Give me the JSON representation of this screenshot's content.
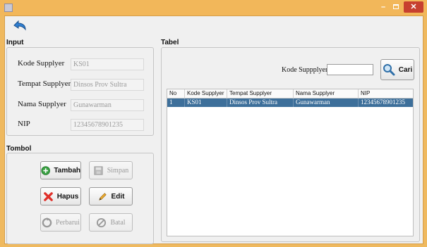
{
  "colors": {
    "titlebar": "#f2b75a",
    "close_button": "#c7402f",
    "selected_row": "#3d6f9a",
    "panel": "#f0f0f0"
  },
  "toolbar": {
    "back_icon": "back-arrow-icon"
  },
  "input_panel": {
    "title": "Input",
    "fields": [
      {
        "label": "Kode Supplyer",
        "value": "KS01"
      },
      {
        "label": "Tempat Supplyer",
        "value": "Dinsos Prov Sultra"
      },
      {
        "label": "Nama Supplyer",
        "value": "Gunawarman"
      },
      {
        "label": "NIP",
        "value": "12345678901235"
      }
    ]
  },
  "tombol_panel": {
    "title": "Tombol",
    "buttons": {
      "tambah": "Tambah",
      "simpan": "Simpan",
      "hapus": "Hapus",
      "edit": "Edit",
      "perbarui": "Perbarui",
      "batal": "Batal"
    }
  },
  "tabel_panel": {
    "title": "Tabel",
    "search_label": "Kode Suppplyer",
    "search_value": "",
    "search_button": "Cari",
    "columns": [
      "No",
      "Kode Supplyer",
      "Tempat Supplyer",
      "Nama Supplyer",
      "NIP"
    ],
    "rows": [
      [
        "1",
        "KS01",
        "Dinsos Prov Sultra",
        "Gunawarman",
        "12345678901235"
      ]
    ]
  }
}
